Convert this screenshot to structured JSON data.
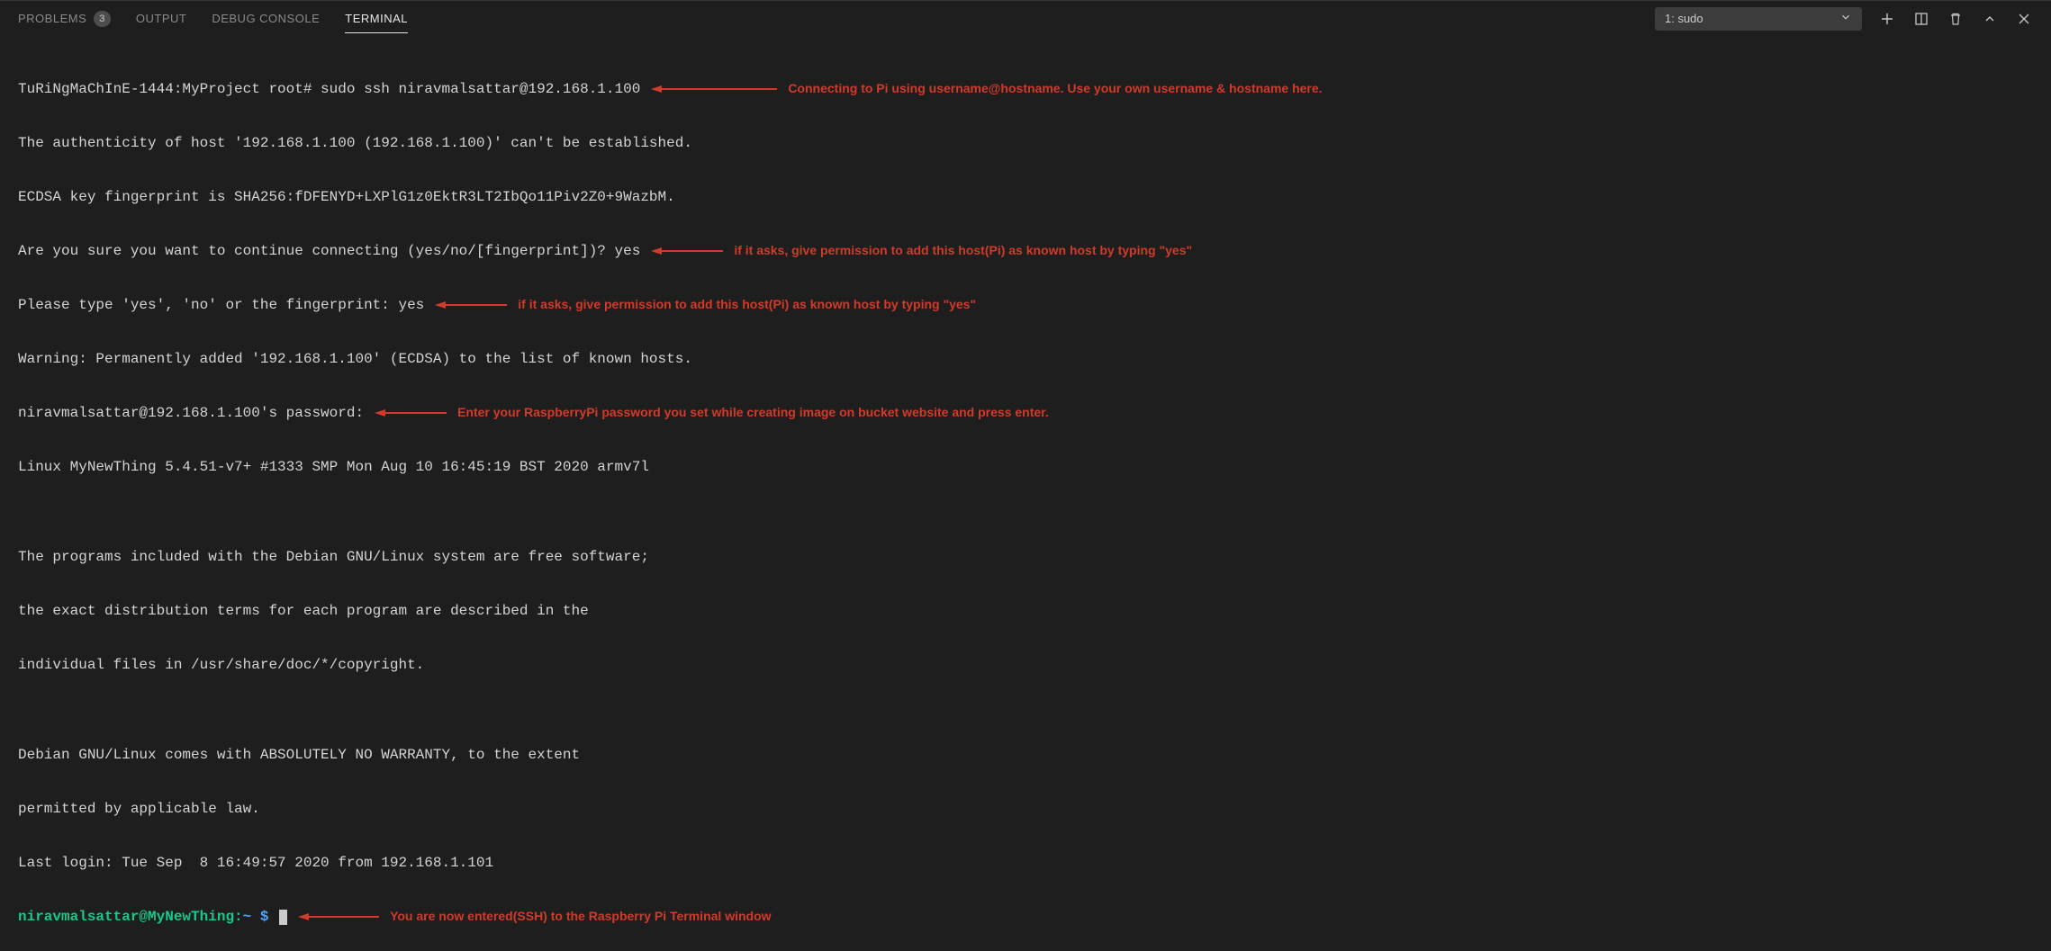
{
  "tabs": {
    "problems": "PROBLEMS",
    "problems_badge": "3",
    "output": "OUTPUT",
    "debug": "DEBUG CONSOLE",
    "terminal": "TERMINAL"
  },
  "terminal_picker": "1: sudo",
  "term": {
    "l1": "TuRiNgMaChInE-1444:MyProject root# sudo ssh niravmalsattar@192.168.1.100",
    "l2": "The authenticity of host '192.168.1.100 (192.168.1.100)' can't be established.",
    "l3": "ECDSA key fingerprint is SHA256:fDFENYD+LXPlG1z0EktR3LT2IbQo11Piv2Z0+9WazbM.",
    "l4": "Are you sure you want to continue connecting (yes/no/[fingerprint])? yes",
    "l5": "Please type 'yes', 'no' or the fingerprint: yes",
    "l6": "Warning: Permanently added '192.168.1.100' (ECDSA) to the list of known hosts.",
    "l7": "niravmalsattar@192.168.1.100's password:",
    "l8": "Linux MyNewThing 5.4.51-v7+ #1333 SMP Mon Aug 10 16:45:19 BST 2020 armv7l",
    "l9": "",
    "l10": "The programs included with the Debian GNU/Linux system are free software;",
    "l11": "the exact distribution terms for each program are described in the",
    "l12": "individual files in /usr/share/doc/*/copyright.",
    "l13": "",
    "l14": "Debian GNU/Linux comes with ABSOLUTELY NO WARRANTY, to the extent",
    "l15": "permitted by applicable law.",
    "l16": "Last login: Tue Sep  8 16:49:57 2020 from 192.168.1.101",
    "prompt_user": "niravmalsattar@MyNewThing",
    "prompt_sep": ":",
    "prompt_path": "~ $"
  },
  "annotations": {
    "a1": "Connecting to Pi using username@hostname. Use your own username & hostname here.",
    "a2": "if it asks, give permission to add this host(Pi) as known host by typing \"yes\"",
    "a3": "if it asks, give permission to add this host(Pi) as known host by typing \"yes\"",
    "a4": "Enter your RaspberryPi password you set while creating image on bucket website and press enter.",
    "a5": "You are now entered(SSH) to the Raspberry Pi Terminal window"
  }
}
